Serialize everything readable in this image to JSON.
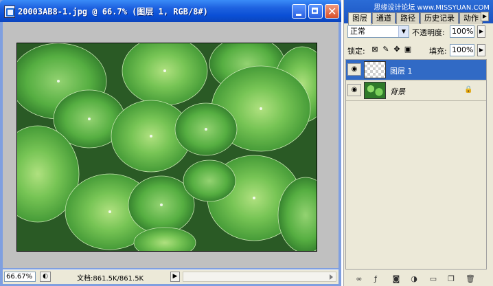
{
  "document": {
    "title": "20003AB8-1.jpg @ 66.7% (图层 1, RGB/8#)",
    "zoom": "66.67%",
    "info": "文档:861.5K/861.5K"
  },
  "panel": {
    "tabs": [
      "图层",
      "通道",
      "路径",
      "历史记录",
      "动作"
    ],
    "watermark": "思缘设计论坛 www.MISSYUAN.COM",
    "blend_mode": "正常",
    "opacity_label": "不透明度:",
    "opacity_value": "100%",
    "lock_label": "锁定:",
    "fill_label": "填充:",
    "fill_value": "100%",
    "layers": [
      {
        "name": "图层 1",
        "selected": true,
        "thumbnail": "transparent"
      },
      {
        "name": "背景",
        "selected": false,
        "thumbnail": "leaves",
        "locked": true
      }
    ]
  },
  "icons": {
    "eye": "eye-icon",
    "lock": "lock-icon"
  }
}
